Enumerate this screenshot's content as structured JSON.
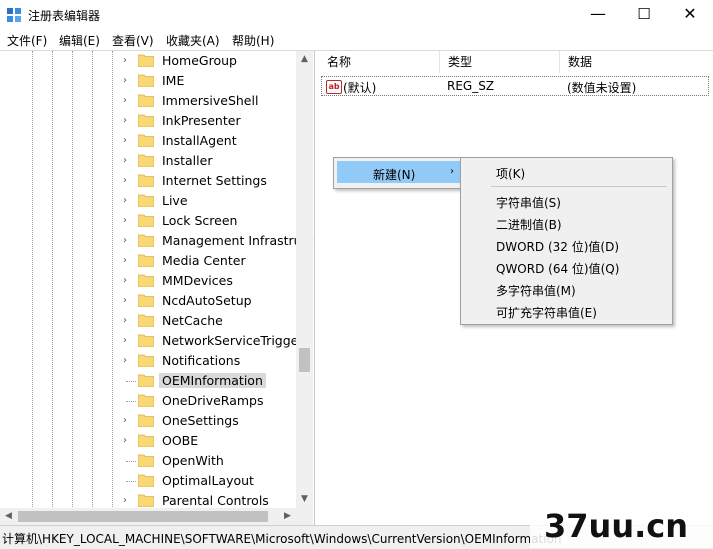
{
  "window": {
    "title": "注册表编辑器"
  },
  "window_buttons": {
    "minimize": "—",
    "maximize": "☐",
    "close": "✕"
  },
  "menu": [
    "文件(F)",
    "编辑(E)",
    "查看(V)",
    "收藏夹(A)",
    "帮助(H)"
  ],
  "tree": {
    "items": [
      {
        "label": "HomeGroup",
        "expandable": true
      },
      {
        "label": "IME",
        "expandable": true
      },
      {
        "label": "ImmersiveShell",
        "expandable": true
      },
      {
        "label": "InkPresenter",
        "expandable": true
      },
      {
        "label": "InstallAgent",
        "expandable": true
      },
      {
        "label": "Installer",
        "expandable": true
      },
      {
        "label": "Internet Settings",
        "expandable": true
      },
      {
        "label": "Live",
        "expandable": true
      },
      {
        "label": "Lock Screen",
        "expandable": true
      },
      {
        "label": "Management Infrastructu",
        "expandable": true
      },
      {
        "label": "Media Center",
        "expandable": true
      },
      {
        "label": "MMDevices",
        "expandable": true
      },
      {
        "label": "NcdAutoSetup",
        "expandable": true
      },
      {
        "label": "NetCache",
        "expandable": true
      },
      {
        "label": "NetworkServiceTriggers",
        "expandable": true
      },
      {
        "label": "Notifications",
        "expandable": true
      },
      {
        "label": "OEMInformation",
        "expandable": false,
        "selected": true
      },
      {
        "label": "OneDriveRamps",
        "expandable": false
      },
      {
        "label": "OneSettings",
        "expandable": true
      },
      {
        "label": "OOBE",
        "expandable": true
      },
      {
        "label": "OpenWith",
        "expandable": false
      },
      {
        "label": "OptimalLayout",
        "expandable": false
      },
      {
        "label": "Parental Controls",
        "expandable": true
      }
    ]
  },
  "columns": {
    "name": "名称",
    "type": "类型",
    "data": "数据"
  },
  "values": [
    {
      "name": "(默认)",
      "type": "REG_SZ",
      "data": "(数值未设置)",
      "icon": "ab"
    }
  ],
  "context_menu": {
    "new_label": "新建(N)",
    "arrow": "›"
  },
  "submenu": {
    "items": [
      "项(K)",
      "字符串值(S)",
      "二进制值(B)",
      "DWORD (32 位)值(D)",
      "QWORD (64 位)值(Q)",
      "多字符串值(M)",
      "可扩充字符串值(E)"
    ]
  },
  "status_bar": {
    "path": "计算机\\HKEY_LOCAL_MACHINE\\SOFTWARE\\Microsoft\\Windows\\CurrentVersion\\OEMInformation"
  },
  "watermark": {
    "text": "37uu.cn"
  },
  "colors": {
    "menu_highlight": "#91c9f7",
    "folder": "#f8d775",
    "selected_bg": "#d9d9d9"
  }
}
